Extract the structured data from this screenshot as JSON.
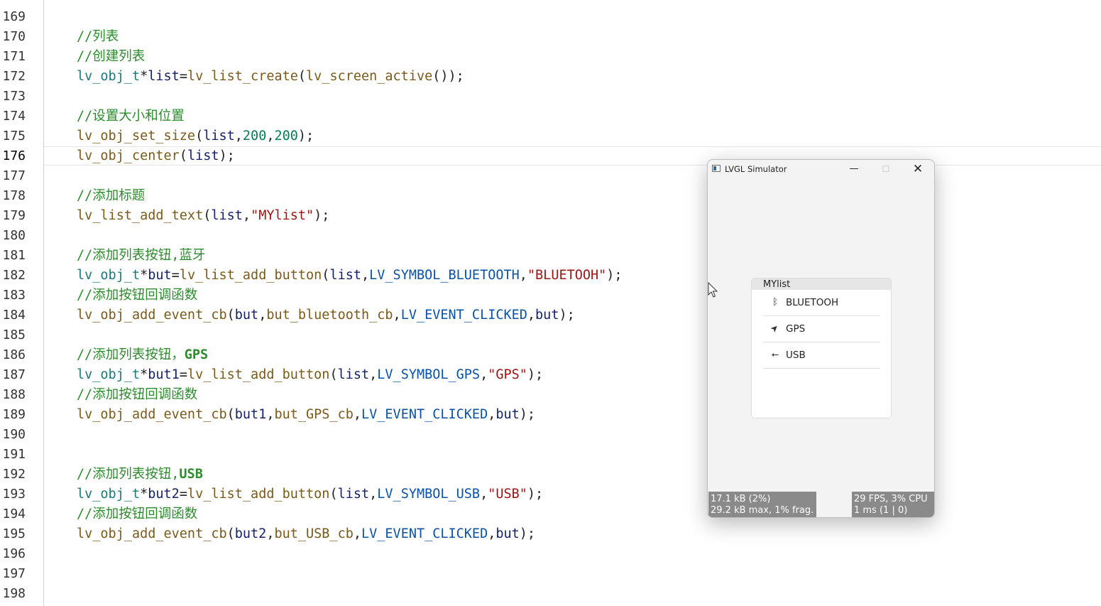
{
  "editor": {
    "current_line": "176",
    "lines": [
      {
        "n": "169",
        "tokens": []
      },
      {
        "n": "170",
        "tokens": [
          {
            "t": "//列表",
            "c": "cm"
          }
        ]
      },
      {
        "n": "171",
        "tokens": [
          {
            "t": "//创建列表",
            "c": "cm"
          }
        ]
      },
      {
        "n": "172",
        "tokens": [
          {
            "t": "lv_obj_t",
            "c": "type"
          },
          {
            "t": "*",
            "c": "p"
          },
          {
            "t": "list",
            "c": "var"
          },
          {
            "t": "=",
            "c": "p"
          },
          {
            "t": "lv_list_create",
            "c": "fn"
          },
          {
            "t": "(",
            "c": "p"
          },
          {
            "t": "lv_screen_active",
            "c": "fn"
          },
          {
            "t": "());",
            "c": "p"
          }
        ]
      },
      {
        "n": "173",
        "tokens": []
      },
      {
        "n": "174",
        "tokens": [
          {
            "t": "//设置大小和位置",
            "c": "cm"
          }
        ]
      },
      {
        "n": "175",
        "tokens": [
          {
            "t": "lv_obj_set_size",
            "c": "fn"
          },
          {
            "t": "(",
            "c": "p"
          },
          {
            "t": "list",
            "c": "var"
          },
          {
            "t": ",",
            "c": "p"
          },
          {
            "t": "200",
            "c": "num"
          },
          {
            "t": ",",
            "c": "p"
          },
          {
            "t": "200",
            "c": "num"
          },
          {
            "t": ");",
            "c": "p"
          }
        ]
      },
      {
        "n": "176",
        "tokens": [
          {
            "t": "lv_obj_center",
            "c": "fn"
          },
          {
            "t": "(",
            "c": "p"
          },
          {
            "t": "list",
            "c": "var"
          },
          {
            "t": ");",
            "c": "p"
          }
        ]
      },
      {
        "n": "177",
        "tokens": []
      },
      {
        "n": "178",
        "tokens": [
          {
            "t": "//添加标题",
            "c": "cm"
          }
        ]
      },
      {
        "n": "179",
        "tokens": [
          {
            "t": "lv_list_add_text",
            "c": "fn"
          },
          {
            "t": "(",
            "c": "p"
          },
          {
            "t": "list",
            "c": "var"
          },
          {
            "t": ",",
            "c": "p"
          },
          {
            "t": "\"MYlist\"",
            "c": "str"
          },
          {
            "t": ");",
            "c": "p"
          }
        ]
      },
      {
        "n": "180",
        "tokens": []
      },
      {
        "n": "181",
        "tokens": [
          {
            "t": "//添加列表按钮,蓝牙",
            "c": "cm"
          }
        ]
      },
      {
        "n": "182",
        "tokens": [
          {
            "t": "lv_obj_t",
            "c": "type"
          },
          {
            "t": "*",
            "c": "p"
          },
          {
            "t": "but",
            "c": "var"
          },
          {
            "t": "=",
            "c": "p"
          },
          {
            "t": "lv_list_add_button",
            "c": "fn"
          },
          {
            "t": "(",
            "c": "p"
          },
          {
            "t": "list",
            "c": "var"
          },
          {
            "t": ",",
            "c": "p"
          },
          {
            "t": "LV_SYMBOL_BLUETOOTH",
            "c": "mac"
          },
          {
            "t": ",",
            "c": "p"
          },
          {
            "t": "\"BLUETOOH\"",
            "c": "str"
          },
          {
            "t": ");",
            "c": "p"
          }
        ]
      },
      {
        "n": "183",
        "tokens": [
          {
            "t": "//添加按钮回调函数",
            "c": "cm"
          }
        ]
      },
      {
        "n": "184",
        "tokens": [
          {
            "t": "lv_obj_add_event_cb",
            "c": "fn"
          },
          {
            "t": "(",
            "c": "p"
          },
          {
            "t": "but",
            "c": "var"
          },
          {
            "t": ",",
            "c": "p"
          },
          {
            "t": "but_bluetooth_cb",
            "c": "fn"
          },
          {
            "t": ",",
            "c": "p"
          },
          {
            "t": "LV_EVENT_CLICKED",
            "c": "mac"
          },
          {
            "t": ",",
            "c": "p"
          },
          {
            "t": "but",
            "c": "var"
          },
          {
            "t": ");",
            "c": "p"
          }
        ]
      },
      {
        "n": "185",
        "tokens": []
      },
      {
        "n": "186",
        "tokens": [
          {
            "t": "//添加列表按钮，",
            "c": "cm"
          },
          {
            "t": "GPS",
            "c": "cm bold"
          }
        ]
      },
      {
        "n": "187",
        "tokens": [
          {
            "t": "lv_obj_t",
            "c": "type"
          },
          {
            "t": "*",
            "c": "p"
          },
          {
            "t": "but1",
            "c": "var"
          },
          {
            "t": "=",
            "c": "p"
          },
          {
            "t": "lv_list_add_button",
            "c": "fn"
          },
          {
            "t": "(",
            "c": "p"
          },
          {
            "t": "list",
            "c": "var"
          },
          {
            "t": ",",
            "c": "p"
          },
          {
            "t": "LV_SYMBOL_GPS",
            "c": "mac"
          },
          {
            "t": ",",
            "c": "p"
          },
          {
            "t": "\"GPS\"",
            "c": "str"
          },
          {
            "t": ");",
            "c": "p"
          }
        ]
      },
      {
        "n": "188",
        "tokens": [
          {
            "t": "//添加按钮回调函数",
            "c": "cm"
          }
        ]
      },
      {
        "n": "189",
        "tokens": [
          {
            "t": "lv_obj_add_event_cb",
            "c": "fn"
          },
          {
            "t": "(",
            "c": "p"
          },
          {
            "t": "but1",
            "c": "var"
          },
          {
            "t": ",",
            "c": "p"
          },
          {
            "t": "but_GPS_cb",
            "c": "fn"
          },
          {
            "t": ",",
            "c": "p"
          },
          {
            "t": "LV_EVENT_CLICKED",
            "c": "mac"
          },
          {
            "t": ",",
            "c": "p"
          },
          {
            "t": "but",
            "c": "var"
          },
          {
            "t": ");",
            "c": "p"
          }
        ]
      },
      {
        "n": "190",
        "tokens": []
      },
      {
        "n": "191",
        "tokens": []
      },
      {
        "n": "192",
        "tokens": [
          {
            "t": "//添加列表按钮,",
            "c": "cm"
          },
          {
            "t": "USB",
            "c": "cm bold"
          }
        ]
      },
      {
        "n": "193",
        "tokens": [
          {
            "t": "lv_obj_t",
            "c": "type"
          },
          {
            "t": "*",
            "c": "p"
          },
          {
            "t": "but2",
            "c": "var"
          },
          {
            "t": "=",
            "c": "p"
          },
          {
            "t": "lv_list_add_button",
            "c": "fn"
          },
          {
            "t": "(",
            "c": "p"
          },
          {
            "t": "list",
            "c": "var"
          },
          {
            "t": ",",
            "c": "p"
          },
          {
            "t": "LV_SYMBOL_USB",
            "c": "mac"
          },
          {
            "t": ",",
            "c": "p"
          },
          {
            "t": "\"USB\"",
            "c": "str"
          },
          {
            "t": ");",
            "c": "p"
          }
        ]
      },
      {
        "n": "194",
        "tokens": [
          {
            "t": "//添加按钮回调函数",
            "c": "cm"
          }
        ]
      },
      {
        "n": "195",
        "tokens": [
          {
            "t": "lv_obj_add_event_cb",
            "c": "fn"
          },
          {
            "t": "(",
            "c": "p"
          },
          {
            "t": "but2",
            "c": "var"
          },
          {
            "t": ",",
            "c": "p"
          },
          {
            "t": "but_USB_cb",
            "c": "fn"
          },
          {
            "t": ",",
            "c": "p"
          },
          {
            "t": "LV_EVENT_CLICKED",
            "c": "mac"
          },
          {
            "t": ",",
            "c": "p"
          },
          {
            "t": "but",
            "c": "var"
          },
          {
            "t": ");",
            "c": "p"
          }
        ]
      },
      {
        "n": "196",
        "tokens": []
      },
      {
        "n": "197",
        "tokens": []
      },
      {
        "n": "198",
        "tokens": []
      }
    ]
  },
  "simulator": {
    "title": "LVGL Simulator",
    "minimize_glyph": "—",
    "maximize_glyph": "☐",
    "close_glyph": "✕",
    "list": {
      "header": "MYlist",
      "items": [
        {
          "label": "BLUETOOH",
          "icon": "bluetooth-icon",
          "glyph": "ᛒ"
        },
        {
          "label": "GPS",
          "icon": "navigation-arrow-icon",
          "glyph": "➤"
        },
        {
          "label": "USB",
          "icon": "usb-icon",
          "glyph": "⭠"
        }
      ]
    },
    "perf_monitor": {
      "mem_line1": "17.1 kB (2%)",
      "mem_line2": "29.2 kB max, 1% frag.",
      "fps_line1": "29 FPS, 3% CPU",
      "fps_line2": "1 ms (1 | 0)"
    }
  }
}
